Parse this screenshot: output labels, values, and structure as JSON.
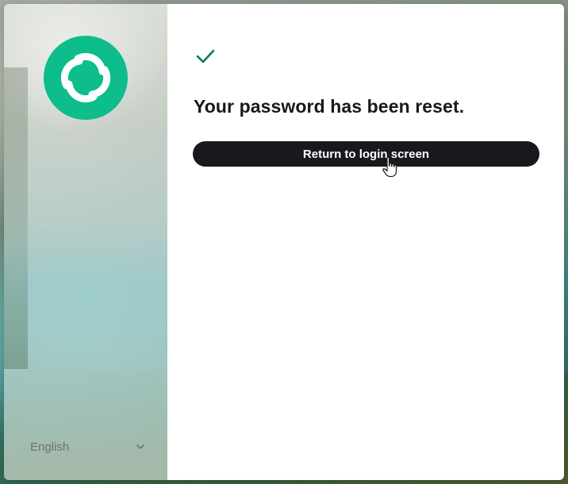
{
  "sidebar": {
    "logo_icon": "element-logo-icon",
    "brand_color": "#0dbd8b",
    "language": {
      "value": "English",
      "icon": "chevron-down-icon"
    }
  },
  "main": {
    "status_icon": "check-icon",
    "status_color": "#0b7a5a",
    "heading": "Your password has been reset.",
    "return_button_label": "Return to login screen",
    "button_color": "#17191c"
  },
  "pointer": {
    "icon": "hand-cursor-icon"
  }
}
